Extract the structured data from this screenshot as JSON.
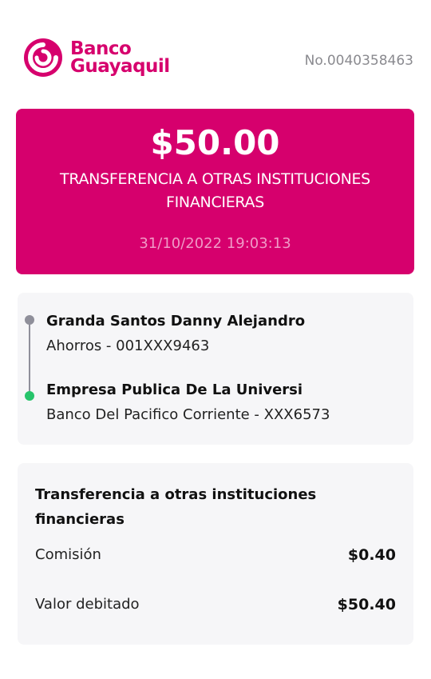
{
  "header": {
    "brand_line1": "Banco",
    "brand_line2": "Guayaquil",
    "receipt_number": "No.0040358463",
    "brand_color": "#D6006D"
  },
  "hero": {
    "amount": "$50.00",
    "description": "TRANSFERENCIA A OTRAS INSTITUCIONES FINANCIERAS",
    "datetime": "31/10/2022 19:03:13"
  },
  "parties": {
    "origin": {
      "name": "Granda Santos Danny Alejandro",
      "account": "Ahorros - 001XXX9463",
      "dot_color": "#8f8f9a"
    },
    "destination": {
      "name": "Empresa Publica De La Universi",
      "account": "Banco Del Pacifico Corriente - XXX6573",
      "dot_color": "#27c46b"
    }
  },
  "details": {
    "title": "Transferencia a otras instituciones financieras",
    "rows": [
      {
        "label": "Comisión",
        "value": "$0.40"
      },
      {
        "label": "Valor debitado",
        "value": "$50.40"
      }
    ]
  }
}
